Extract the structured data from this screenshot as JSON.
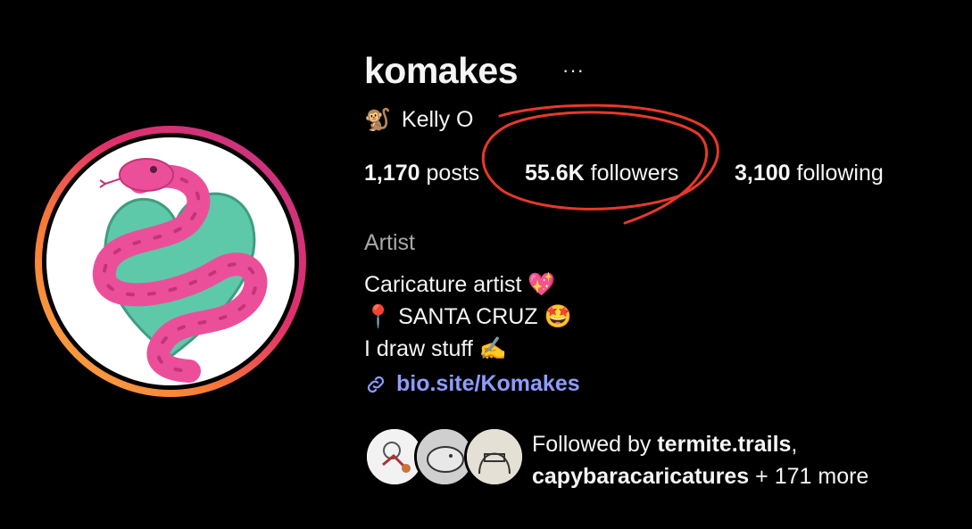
{
  "profile": {
    "username": "komakes",
    "more_label": "···",
    "full_name": "Kelly O",
    "name_icon": "monkey-emoji",
    "stats": [
      {
        "value": "1,170",
        "label": "posts"
      },
      {
        "value": "55.6K",
        "label": "followers"
      },
      {
        "value": "3,100",
        "label": "following"
      }
    ],
    "category": "Artist",
    "bio_lines": [
      "Caricature artist 💖",
      "📍 SANTA CRUZ 🤩",
      "I draw stuff ✍️"
    ],
    "link": "bio.site/Komakes",
    "followed_by": {
      "prefix": "Followed by",
      "user1": "termite.trails",
      "sep": ",",
      "user2": "capybaracaricatures",
      "suffix": "+ 171 more"
    }
  },
  "colors": {
    "background": "#000000",
    "text": "#f5f5f5",
    "secondary_text": "#a8a8a8",
    "link": "#8e9cff",
    "annotation": "#e8382a",
    "snake_pink": "#ec4f9a",
    "heart_teal": "#5ec9a8"
  }
}
